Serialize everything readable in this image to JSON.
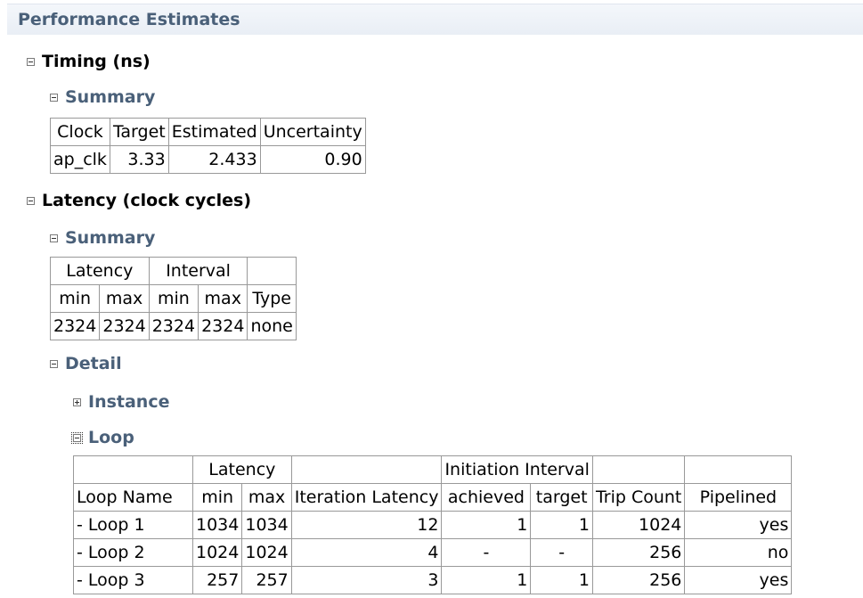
{
  "page_title": "Performance Estimates",
  "timing": {
    "heading": "Timing (ns)",
    "summary_heading": "Summary",
    "headers": [
      "Clock",
      "Target",
      "Estimated",
      "Uncertainty"
    ],
    "row": [
      "ap_clk",
      "3.33",
      "2.433",
      "0.90"
    ]
  },
  "latency": {
    "heading": "Latency (clock cycles)",
    "summary_heading": "Summary",
    "group_headers": [
      "Latency",
      "Interval",
      ""
    ],
    "sub_headers": [
      "min",
      "max",
      "min",
      "max",
      "Type"
    ],
    "row": [
      "2324",
      "2324",
      "2324",
      "2324",
      "none"
    ],
    "detail_heading": "Detail",
    "instance_heading": "Instance",
    "loop_heading": "Loop",
    "loop_table": {
      "group_headers": [
        "",
        "Latency",
        "",
        "Initiation Interval",
        "",
        ""
      ],
      "headers": [
        "Loop Name",
        "min",
        "max",
        "Iteration Latency",
        "achieved",
        "target",
        "Trip Count",
        "Pipelined"
      ],
      "rows": [
        [
          "- Loop 1",
          "1034",
          "1034",
          "12",
          "1",
          "1",
          "1024",
          "yes"
        ],
        [
          "- Loop 2",
          "1024",
          "1024",
          "4",
          "-",
          "-",
          "256",
          "no"
        ],
        [
          "- Loop 3",
          "257",
          "257",
          "3",
          "1",
          "1",
          "256",
          "yes"
        ]
      ]
    }
  }
}
